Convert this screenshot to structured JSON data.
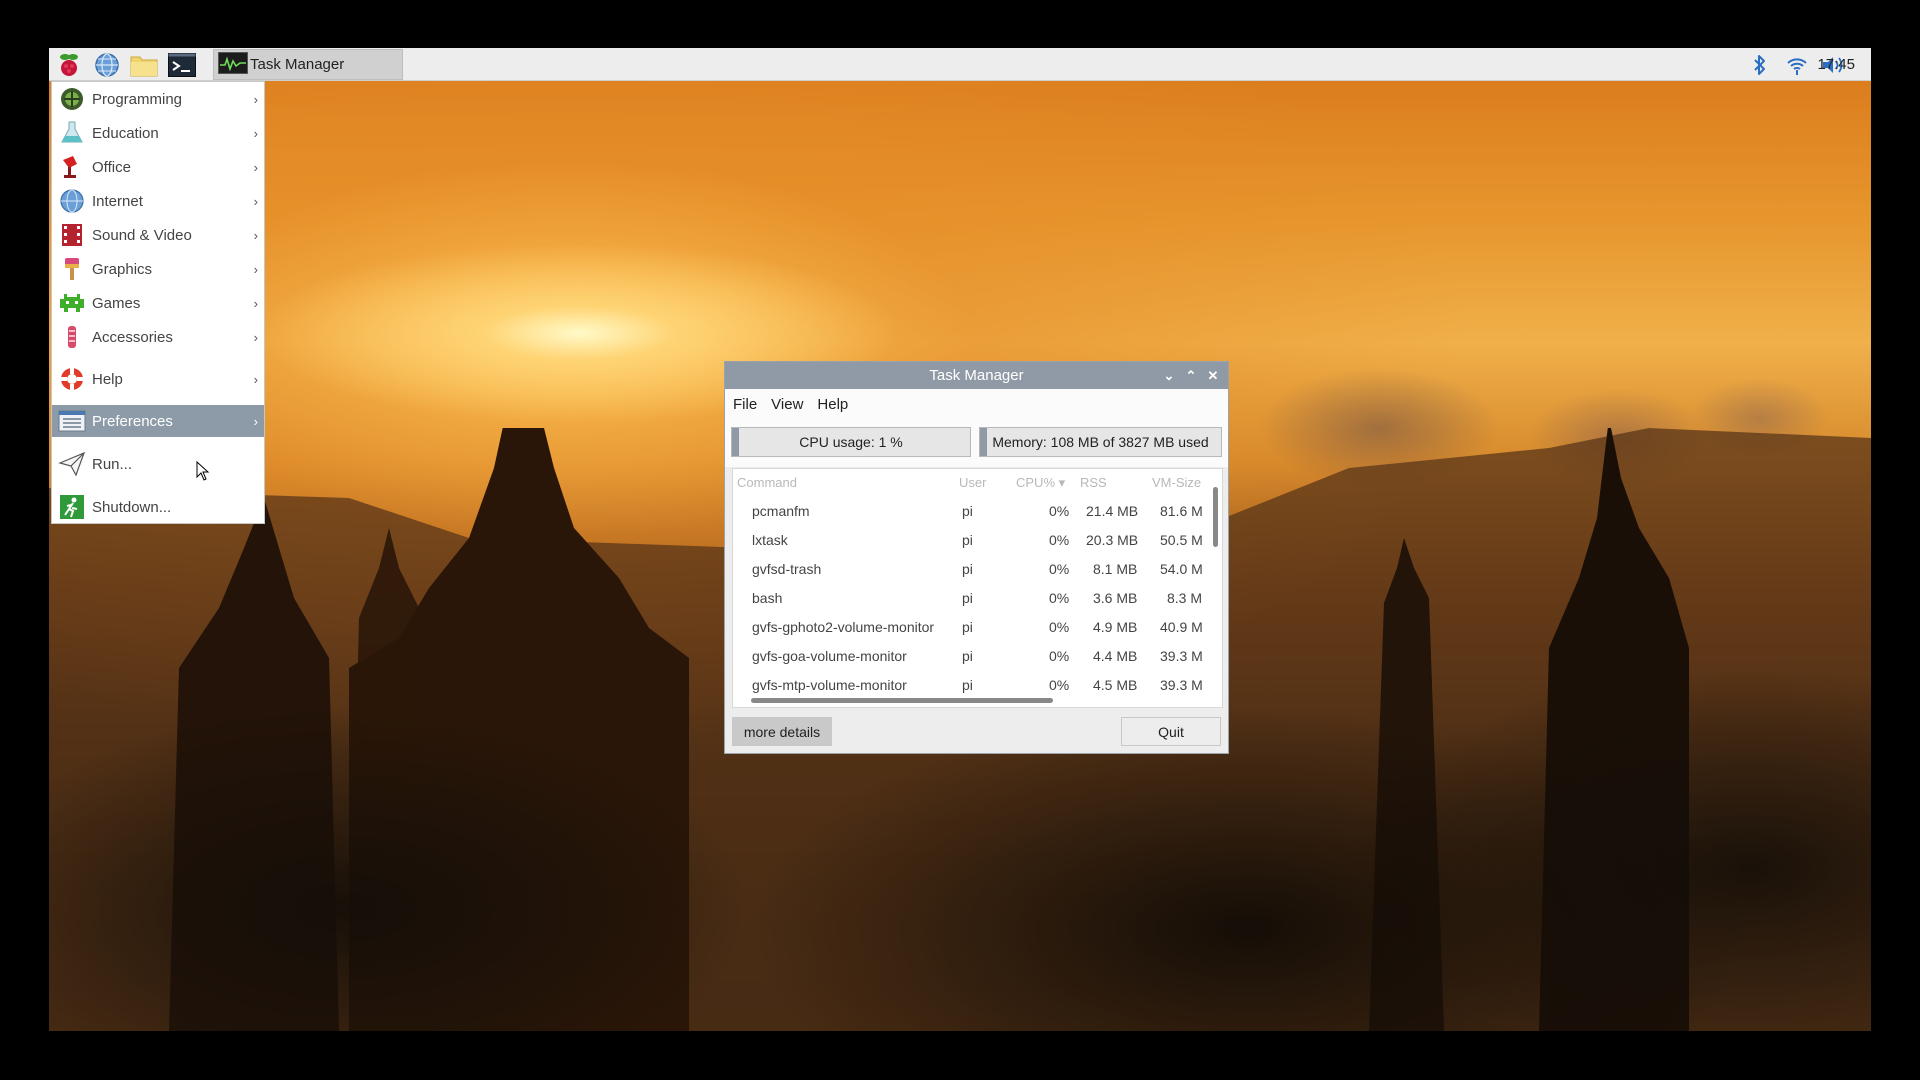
{
  "taskbar": {
    "launchers": [
      {
        "name": "raspberry-menu-icon"
      },
      {
        "name": "web-browser-icon"
      },
      {
        "name": "file-manager-icon"
      },
      {
        "name": "terminal-icon"
      }
    ],
    "task_button": {
      "label": "Task Manager",
      "icon": "task-manager-icon"
    },
    "tray": {
      "bluetooth": "bluetooth-icon",
      "wifi": "wifi-icon",
      "volume": "volume-icon"
    },
    "clock": "17:45"
  },
  "menu": {
    "items": [
      {
        "label": "Programming",
        "icon": "programming-icon",
        "submenu": true
      },
      {
        "label": "Education",
        "icon": "education-icon",
        "submenu": true
      },
      {
        "label": "Office",
        "icon": "office-icon",
        "submenu": true
      },
      {
        "label": "Internet",
        "icon": "internet-icon",
        "submenu": true
      },
      {
        "label": "Sound & Video",
        "icon": "sound-video-icon",
        "submenu": true
      },
      {
        "label": "Graphics",
        "icon": "graphics-icon",
        "submenu": true
      },
      {
        "label": "Games",
        "icon": "games-icon",
        "submenu": true
      },
      {
        "label": "Accessories",
        "icon": "accessories-icon",
        "submenu": true
      },
      {
        "label": "Help",
        "icon": "help-icon",
        "submenu": true
      },
      {
        "label": "Preferences",
        "icon": "preferences-icon",
        "submenu": true,
        "selected": true
      },
      {
        "label": "Run...",
        "icon": "run-icon",
        "submenu": false
      },
      {
        "label": "Shutdown...",
        "icon": "shutdown-icon",
        "submenu": false
      }
    ],
    "arrow": "›"
  },
  "task_manager": {
    "title": "Task Manager",
    "controls": {
      "minimize": "⌄",
      "maximize": "⌃",
      "close": "✕"
    },
    "menubar": [
      "File",
      "View",
      "Help"
    ],
    "cpu_usage": {
      "label": "CPU usage: 1 %",
      "fraction": 0.01
    },
    "memory": {
      "label": "Memory: 108 MB of 3827 MB used",
      "fraction": 0.028
    },
    "columns": [
      "Command",
      "User",
      "CPU% ▾",
      "RSS",
      "VM-Size"
    ],
    "rows": [
      {
        "command": "pcmanfm",
        "user": "pi",
        "cpu": "0%",
        "rss": "21.4 MB",
        "vm": "81.6 M"
      },
      {
        "command": "lxtask",
        "user": "pi",
        "cpu": "0%",
        "rss": "20.3 MB",
        "vm": "50.5 M"
      },
      {
        "command": "gvfsd-trash",
        "user": "pi",
        "cpu": "0%",
        "rss": "8.1 MB",
        "vm": "54.0 M"
      },
      {
        "command": "bash",
        "user": "pi",
        "cpu": "0%",
        "rss": "3.6 MB",
        "vm": "8.3 M"
      },
      {
        "command": "gvfs-gphoto2-volume-monitor",
        "user": "pi",
        "cpu": "0%",
        "rss": "4.9 MB",
        "vm": "40.9 M"
      },
      {
        "command": "gvfs-goa-volume-monitor",
        "user": "pi",
        "cpu": "0%",
        "rss": "4.4 MB",
        "vm": "39.3 M"
      },
      {
        "command": "gvfs-mtp-volume-monitor",
        "user": "pi",
        "cpu": "0%",
        "rss": "4.5 MB",
        "vm": "39.3 M"
      }
    ],
    "buttons": {
      "more_details": "more details",
      "quit": "Quit"
    }
  },
  "colors": {
    "titlebar": "#8f9aa6",
    "menu_selected": "#8d9aa8",
    "taskbar": "#ededed"
  }
}
